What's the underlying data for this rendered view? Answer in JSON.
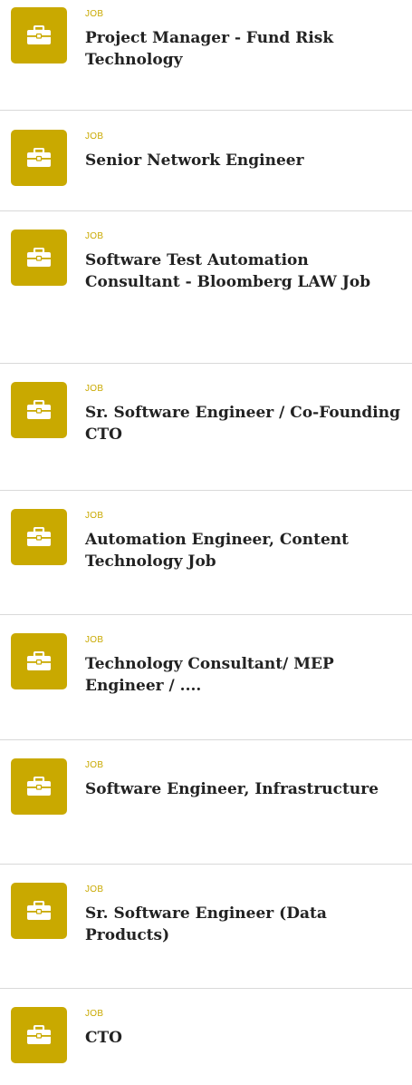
{
  "accent_color": "#c9a900",
  "divider_color": "#d9d9d9",
  "icon_name": "briefcase-icon",
  "results": [
    {
      "type_label": "JOB",
      "title": "Project Manager - Fund Risk Technology"
    },
    {
      "type_label": "JOB",
      "title": "Senior Network Engineer"
    },
    {
      "type_label": "JOB",
      "title": "Software Test Automation Consultant - Bloomberg LAW Job"
    },
    {
      "type_label": "JOB",
      "title": "Sr. Software Engineer / Co-Founding CTO"
    },
    {
      "type_label": "JOB",
      "title": "Automation Engineer, Content Technology Job"
    },
    {
      "type_label": "JOB",
      "title": "Technology Consultant/ MEP Engineer / ...."
    },
    {
      "type_label": "JOB",
      "title": "Software Engineer, Infrastructure"
    },
    {
      "type_label": "JOB",
      "title": "Sr. Software Engineer (Data Products)"
    },
    {
      "type_label": "JOB",
      "title": "CTO"
    }
  ]
}
